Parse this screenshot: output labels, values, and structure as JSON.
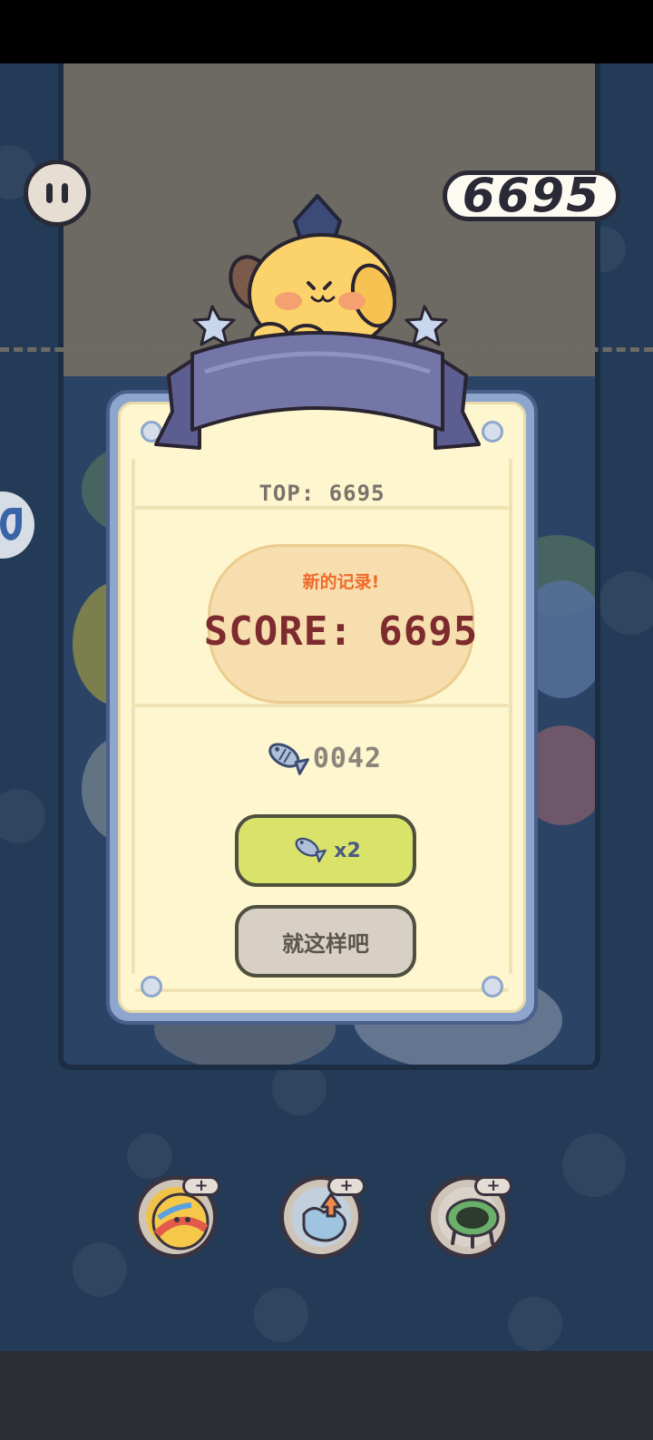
{
  "hud": {
    "current_score": "6695"
  },
  "dialog": {
    "top_score_text": "TOP: 6695",
    "new_record_text": "新的记录!",
    "score_text": "SCORE: 6695",
    "fish_count": "0042",
    "double_button_label": "x2",
    "skip_button_label": "就这样吧"
  },
  "powerups": [
    {
      "icon": "ball-icon",
      "plus": "+"
    },
    {
      "icon": "puzzle-icon",
      "plus": "+"
    },
    {
      "icon": "trampoline-icon",
      "plus": "+"
    }
  ],
  "colors": {
    "background": "#243b58",
    "dialog_cream": "#fdf6cf",
    "score_red": "#7d2b2e",
    "new_record_orange": "#ef6a2b",
    "double_button": "#d9e36a",
    "skip_button": "#d8cfc5",
    "ribbon": "#7476a8"
  }
}
